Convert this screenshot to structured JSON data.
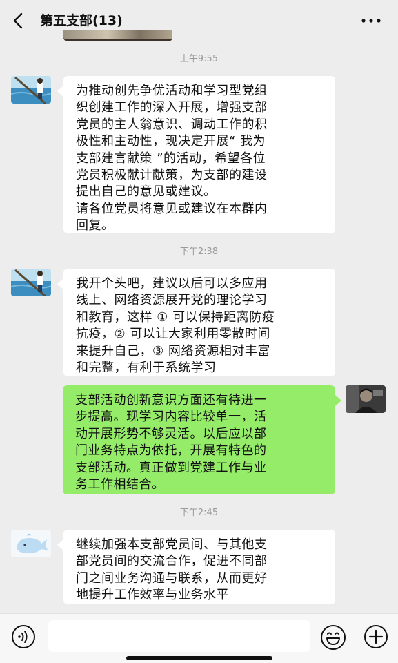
{
  "header": {
    "title": "第五支部(13)"
  },
  "messages": [
    {
      "timestamp": "上午9:55",
      "side": "left",
      "avatar": "sea-photo-avatar",
      "text": "为推动创先争优活动和学习型党组\n织创建工作的深入开展，增强支部\n党员的主人翁意识、调动工作的积\n极性和主动性，现决定开展“ 我为\n支部建言献策 ”的活动，希望各位\n党员积极献计献策，为支部的建设\n提出自己的意见或建议。\n请各位党员将意见或建议在本群内\n回复。"
    },
    {
      "timestamp": "下午2:38",
      "side": "left",
      "avatar": "sea-photo-avatar",
      "text": "我开个头吧，建议以后可以多应用\n线上、网络资源展开党的理论学习\n和教育，这样 ① 可以保持距离防疫\n抗疫，② 可以让大家利用零散时间\n来提升自己，③ 网络资源相对丰富\n和完整，有利于系统学习"
    },
    {
      "side": "right",
      "avatar": "person-photo-avatar",
      "text": "支部活动创新意识方面还有待进一\n步提高。现学习内容比较单一，活\n动开展形势不够灵活。以后应以部\n门业务特点为依托，开展有特色的\n支部活动。真正做到党建工作与业\n务工作相结合。"
    },
    {
      "timestamp": "下午2:45",
      "side": "left",
      "avatar": "whale-avatar",
      "text": "继续加强本支部党员间、与其他支\n部党员间的交流合作，促进不同部\n门之间业务沟通与联系，从而更好\n地提升工作效率与业务水平"
    }
  ],
  "colors": {
    "background": "#ededed",
    "own_bubble": "#95ec69",
    "other_bubble": "#ffffff",
    "timestamp_text": "#9a9a9a"
  },
  "input_bar": {
    "icons": [
      "voice-icon",
      "emoji-icon",
      "plus-icon"
    ]
  }
}
